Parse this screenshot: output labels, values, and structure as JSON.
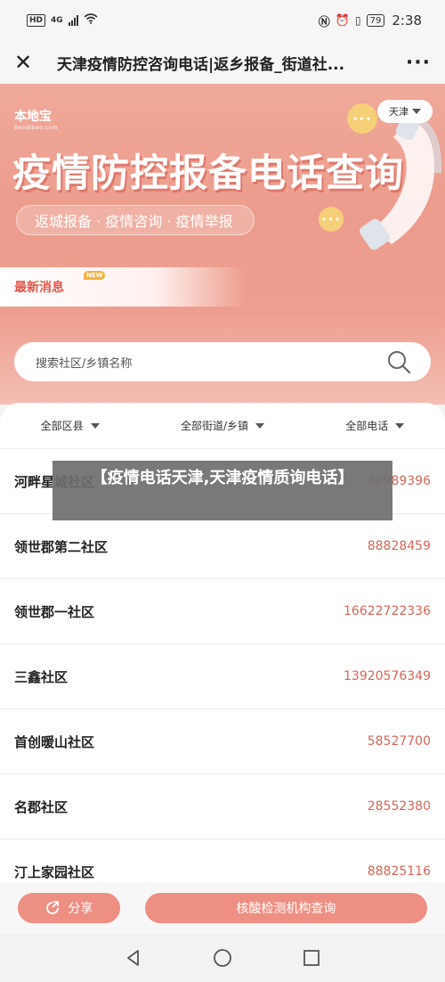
{
  "status_bar": {
    "left_badge": "HD",
    "network": "4G",
    "battery": "79",
    "time": "2:38"
  },
  "title_bar": {
    "title": "天津疫情防控咨询电话|返乡报备_街道社..."
  },
  "banner": {
    "logo_main": "本地宝",
    "logo_sub": "Bendibao.com",
    "hero_title": "疫情防控报备电话查询",
    "tagline": "返城报备 · 疫情咨询 · 疫情举报",
    "city_selector": "天津",
    "news_label": "最新消息",
    "new_tag": "NEW"
  },
  "search": {
    "placeholder": "搜索社区/乡镇名称"
  },
  "filters": [
    {
      "label": "全部区县"
    },
    {
      "label": "全部街道/乡镇"
    },
    {
      "label": "全部电话"
    }
  ],
  "rows": [
    {
      "name": "河畔星城社区",
      "phone": "88989396"
    },
    {
      "name": "领世郡第二社区",
      "phone": "88828459"
    },
    {
      "name": "领世郡一社区",
      "phone": "16622722336"
    },
    {
      "name": "三鑫社区",
      "phone": "13920576349"
    },
    {
      "name": "首创暖山社区",
      "phone": "58527700"
    },
    {
      "name": "名郡社区",
      "phone": "28552380"
    },
    {
      "name": "汀上家园社区",
      "phone": "88825116"
    }
  ],
  "overlay_caption": "【疫情电话天津,天津疫情质询电话】",
  "bottom": {
    "share_label": "分享",
    "check_label": "核酸检测机构查询"
  },
  "colors": {
    "accent": "#ed8f82",
    "banner": "#ef a597",
    "phone_text": "#d9655a"
  }
}
